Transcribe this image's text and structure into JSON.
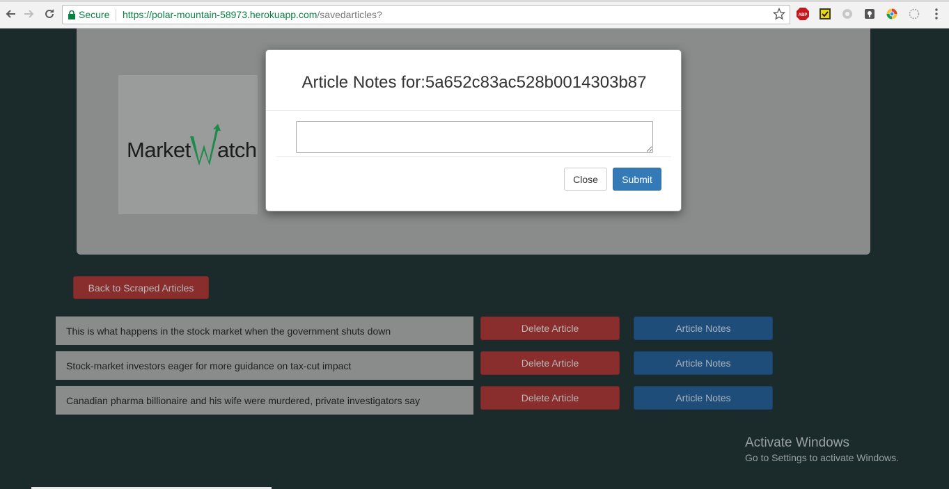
{
  "browser": {
    "secure_label": "Secure",
    "url_host": "https://polar-mountain-58973.herokuapp.com",
    "url_path": "/savedarticles?",
    "extensions": [
      "abp-icon",
      "checkmark-extension-icon",
      "circle-extension-icon",
      "keep-extension-icon",
      "chrome-extension-icon",
      "dotted-circle-extension-icon"
    ],
    "abp_label": "ABP"
  },
  "jumbotron": {
    "logo_text": "MarketWatch",
    "logo_colors": {
      "text": "#1c1c1c",
      "mark": "#1e8a4a"
    }
  },
  "back_button": {
    "label": "Back to Scraped Articles"
  },
  "articles": [
    {
      "title": "This is what happens in the stock market when the government shuts down",
      "delete_label": "Delete Article",
      "notes_label": "Article Notes"
    },
    {
      "title": "Stock-market investors eager for more guidance on tax-cut impact",
      "delete_label": "Delete Article",
      "notes_label": "Article Notes"
    },
    {
      "title": "Canadian pharma billionaire and his wife were murdered, private investigators say",
      "delete_label": "Delete Article",
      "notes_label": "Article Notes"
    }
  ],
  "modal": {
    "title": "Article Notes for:5a652c83ac528b0014303b87",
    "textarea_value": "",
    "close_label": "Close",
    "submit_label": "Submit"
  },
  "watermark": {
    "title": "Activate Windows",
    "subtitle": "Go to Settings to activate Windows."
  },
  "colors": {
    "page_bg": "#1b2a2b",
    "danger": "#d9534f",
    "primary": "#337ab7"
  }
}
